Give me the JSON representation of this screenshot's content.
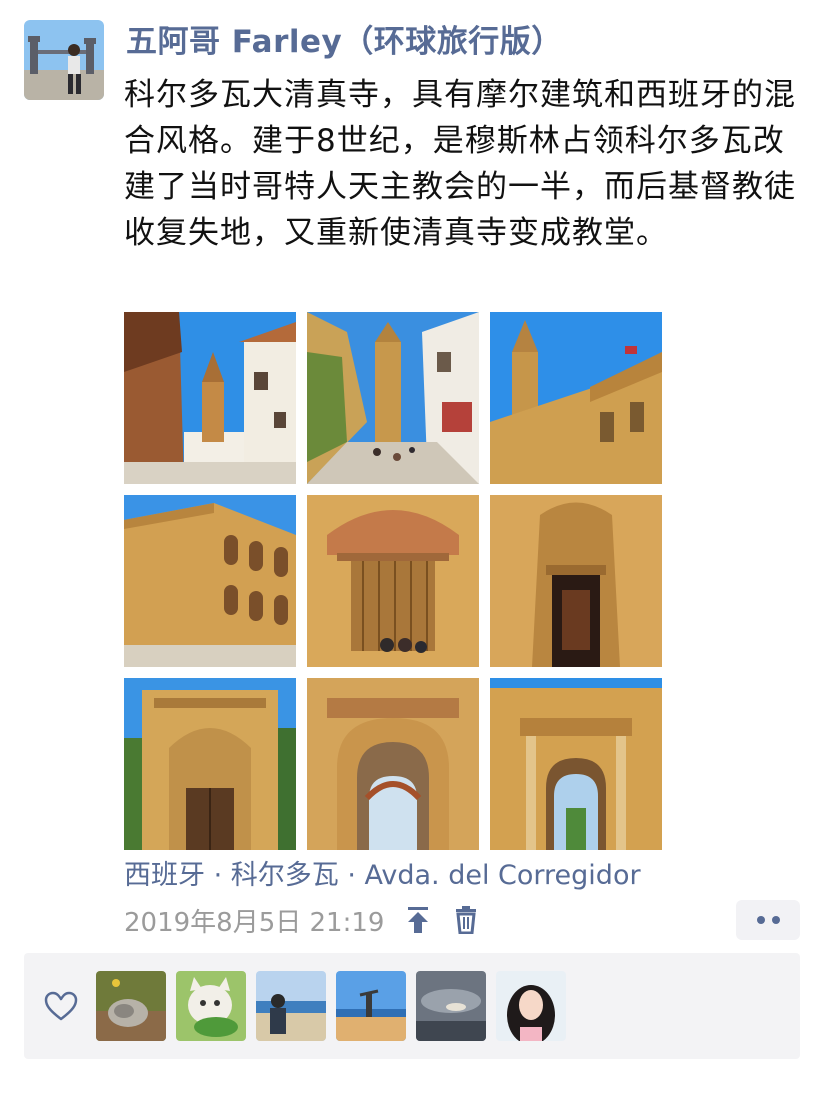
{
  "post": {
    "author": "五阿哥 Farley（环球旅行版）",
    "text": "科尔多瓦大清真寺，具有摩尔建筑和西班牙的混合风格。建于8世纪，是穆斯林占领科尔多瓦改建了当时哥特人天主教会的一半，而后基督教徒收复失地，又重新使清真寺变成教堂。",
    "location": "西班牙 · 科尔多瓦 · Avda. del Corregidor",
    "time": "2019年8月5日 21:19"
  },
  "photos": [
    {
      "subject": "narrow street with bell tower between white houses"
    },
    {
      "subject": "street leading to bell tower with tourists"
    },
    {
      "subject": "bell tower above crenellated mosque wall"
    },
    {
      "subject": "mosque wall with arcaded gallery"
    },
    {
      "subject": "wooden door with horseshoe arch and visitors"
    },
    {
      "subject": "ornate doorway with dark entrance"
    },
    {
      "subject": "gothic carved portal"
    },
    {
      "subject": "moorish horseshoe arch gate"
    },
    {
      "subject": "arched gate with view to street"
    }
  ],
  "likes": {
    "avatars": [
      {
        "subject": "cat lying on grass"
      },
      {
        "subject": "cat with green leaf"
      },
      {
        "subject": "person on beach"
      },
      {
        "subject": "person doing handstand on beach"
      },
      {
        "subject": "cloudy sky"
      },
      {
        "subject": "girl portrait"
      }
    ]
  },
  "colors": {
    "name_link": "#576b95",
    "timestamp": "#9b9b9b",
    "likes_bg": "#f3f3f5",
    "sky": "#2f8fe6",
    "stone": "#d6a44f"
  },
  "icons": [
    "pin-top-icon",
    "delete-icon",
    "more-icon",
    "like-heart-icon"
  ]
}
